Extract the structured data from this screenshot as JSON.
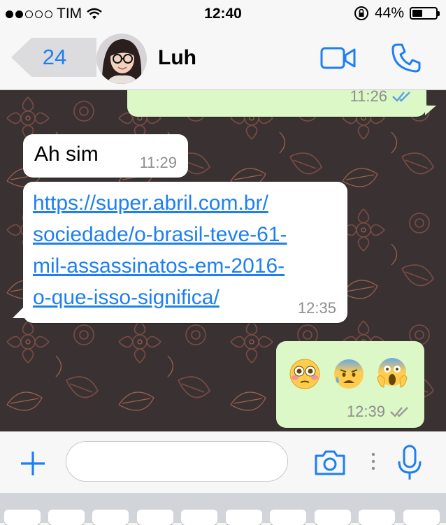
{
  "status_bar": {
    "carrier": "TIM",
    "signal_bars": 2,
    "signal_total": 5,
    "time": "12:40",
    "battery_percent": "44%",
    "battery_level": 0.44
  },
  "header": {
    "back_count": "24",
    "contact_name": "Luh",
    "icons": [
      "video-call-icon",
      "phone-icon"
    ]
  },
  "messages": [
    {
      "id": "m0",
      "direction": "out",
      "text": "",
      "time": "11:26",
      "status": "read"
    },
    {
      "id": "m1",
      "direction": "in",
      "text": "Ah sim",
      "time": "11:29"
    },
    {
      "id": "m2",
      "direction": "in",
      "link_lines": [
        "https://super.abril.com.br/",
        "sociedade/o-brasil-teve-61-",
        "mil-assassinatos-em-2016-",
        "o-que-isso-significa/"
      ],
      "time": "12:35"
    },
    {
      "id": "m3",
      "direction": "out",
      "emojis": [
        "flushed-face",
        "anxious-face-with-sweat",
        "face-screaming-in-fear"
      ],
      "time": "12:39",
      "status": "delivered"
    }
  ],
  "input_bar": {
    "placeholder": "",
    "icons": [
      "plus-icon",
      "camera-icon",
      "more-icon",
      "microphone-icon"
    ]
  },
  "colors": {
    "accent": "#1d7ff2",
    "bubble_out": "#dcf8c6",
    "bubble_in": "#ffffff",
    "read_ticks": "#5aa0e6",
    "delivered_ticks": "#9a9a9a",
    "wallpaper": "#3a3232"
  }
}
